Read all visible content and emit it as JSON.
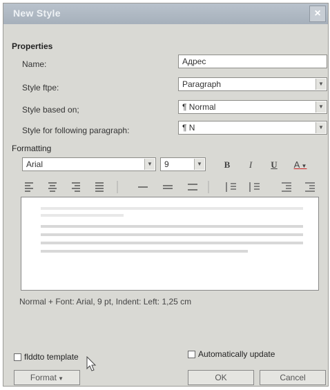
{
  "window": {
    "title": "New Style",
    "close_glyph": "×"
  },
  "properties": {
    "heading": "Properties",
    "name_label": "Name:",
    "name_value": "Адрес",
    "style_type_label": "Style ftpe:",
    "style_type_value": "Paragraph",
    "based_on_label": "Style based on;",
    "based_on_value": "¶ Normal",
    "following_label": "Style for following paragraph:",
    "following_value": "¶ N"
  },
  "formatting": {
    "heading": "Formatting",
    "font_value": "Arial",
    "size_value": "9",
    "bold": "B",
    "italic": "I",
    "underline": "U",
    "font_color": "A",
    "accent_red": "#cc2222"
  },
  "description": "Normal + Font: Arial, 9 pt, Indent: Left: 1,25 cm",
  "footer": {
    "add_to_template": "flddto template",
    "auto_update": "Automatically update",
    "format_button": "Format",
    "ok_button": "OK",
    "cancel_button": "Cancel"
  }
}
